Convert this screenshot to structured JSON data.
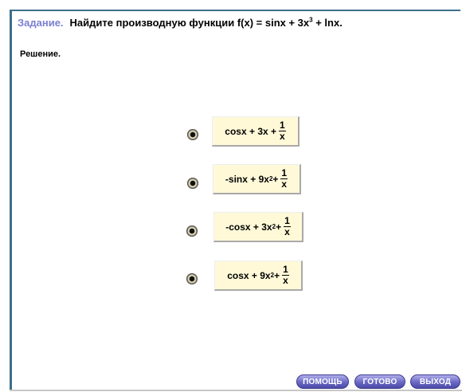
{
  "task": {
    "label": "Задание.",
    "text_before": "Найдите производную функции  f(x) = sinx + 3x",
    "exp": "3",
    "text_after": " + lnx."
  },
  "solution_label": "Решение.",
  "options": [
    {
      "prefix": "cosx + 3x +",
      "exp": "",
      "suffix": "",
      "num": "1",
      "den": "x"
    },
    {
      "prefix": "-sinx + 9x",
      "exp": "2",
      "suffix": " +",
      "num": "1",
      "den": "x"
    },
    {
      "prefix": "-cosx + 3x",
      "exp": "2",
      "suffix": " +",
      "num": "1",
      "den": "x"
    },
    {
      "prefix": "cosx + 9x",
      "exp": "2",
      "suffix": " +",
      "num": "1",
      "den": "x"
    }
  ],
  "buttons": {
    "help": "помощь",
    "done": "готово",
    "exit": "выход"
  },
  "colors": {
    "label": "#7b7fd0",
    "frame": "#3c6f8a",
    "option_bg": "#fff9d8",
    "button": "#6a68c3"
  }
}
